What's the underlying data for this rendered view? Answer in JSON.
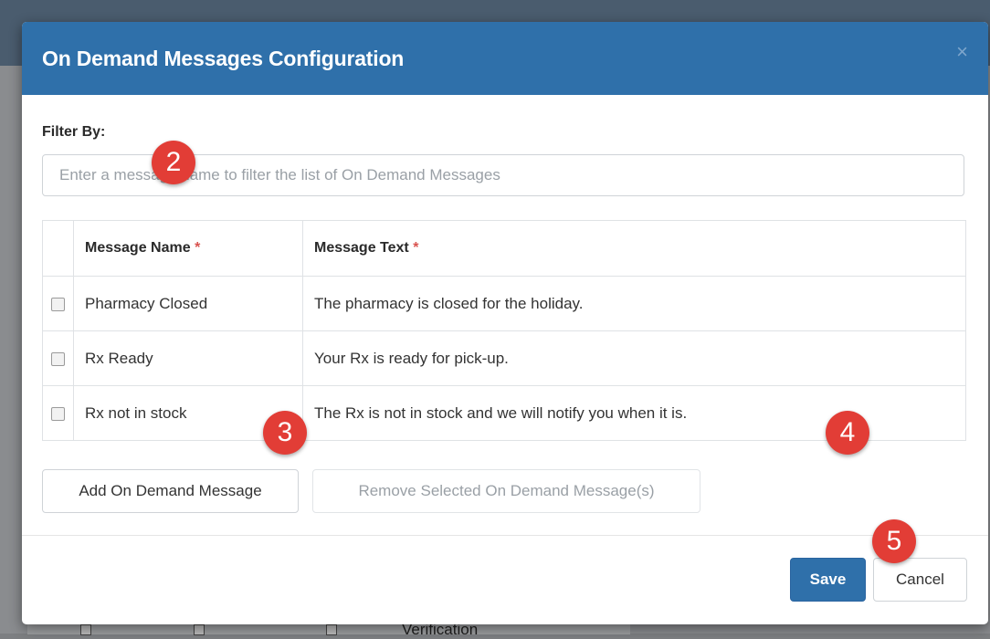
{
  "background": {
    "partial_text": "Verification"
  },
  "dialog": {
    "title": "On Demand Messages Configuration",
    "close_glyph": "×"
  },
  "filter": {
    "label": "Filter By:",
    "placeholder": "Enter a message name to filter the list of On Demand Messages",
    "value": ""
  },
  "table": {
    "columns": [
      {
        "label": "Message Name",
        "required_marker": "*"
      },
      {
        "label": "Message Text",
        "required_marker": "*"
      }
    ],
    "rows": [
      {
        "checked": false,
        "name": "Pharmacy Closed",
        "text": "The pharmacy is closed for the holiday."
      },
      {
        "checked": false,
        "name": "Rx Ready",
        "text": "Your Rx is ready for pick-up."
      },
      {
        "checked": false,
        "name": "Rx not in stock",
        "text": "The Rx is not in stock and we will notify you when it is."
      }
    ]
  },
  "buttons": {
    "add_label": "Add On Demand Message",
    "remove_label": "Remove Selected On Demand Message(s)",
    "save_label": "Save",
    "cancel_label": "Cancel"
  },
  "callouts": [
    "2",
    "3",
    "4",
    "5"
  ],
  "colors": {
    "header_blue": "#2f70aa",
    "primary_button": "#2f70aa",
    "callout_red": "#e23d36",
    "required_red": "#d9534f"
  }
}
